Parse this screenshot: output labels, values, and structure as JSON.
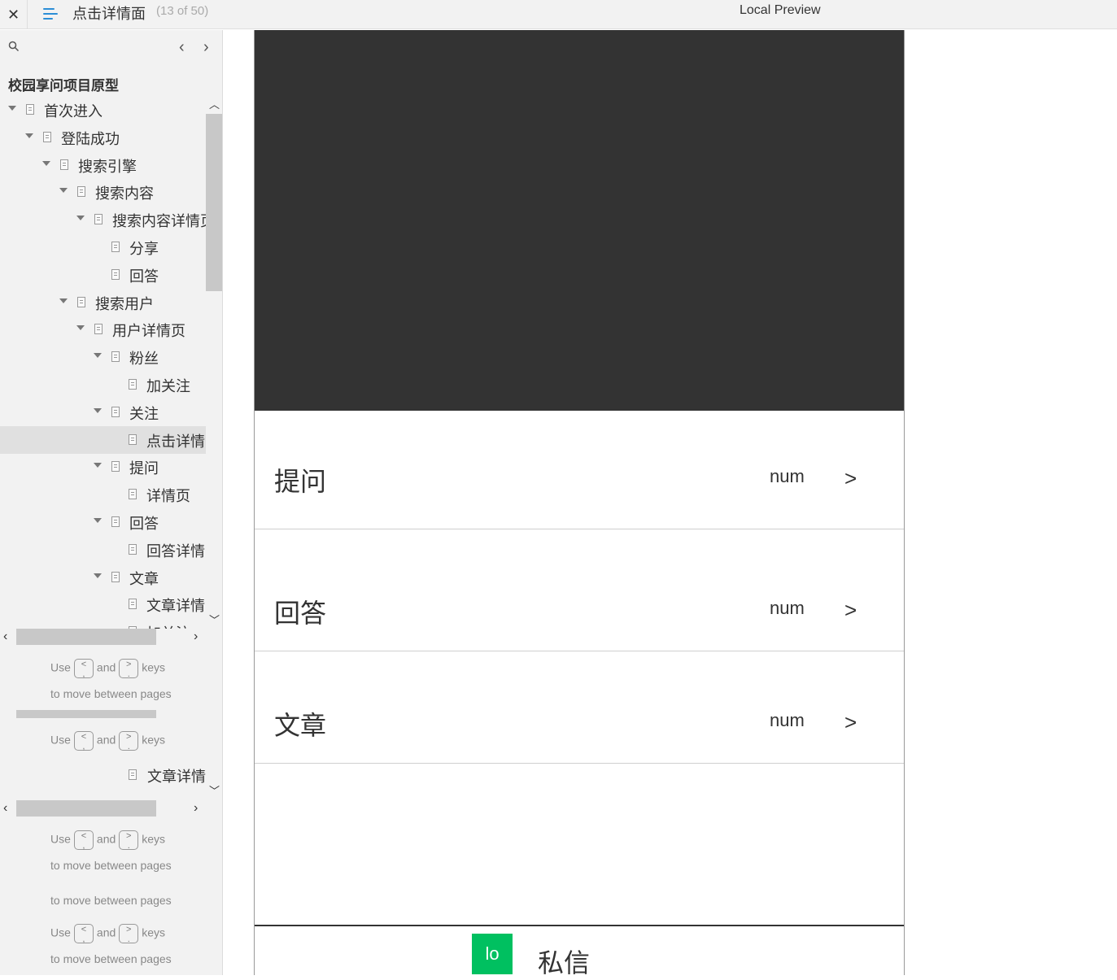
{
  "topbar": {
    "close_glyph": "✕",
    "menu_icon": "menu-icon",
    "page_title": "点击详情面",
    "page_count": "(13 of 50)",
    "preview_label": "Local Preview"
  },
  "sidebar": {
    "search_icon": "search-icon",
    "prev_glyph": "‹",
    "next_glyph": "›",
    "project_title": "校园享问项目原型",
    "tree": [
      {
        "label": "首次进入",
        "depth": 0,
        "expanded": true
      },
      {
        "label": "登陆成功",
        "depth": 1,
        "expanded": true
      },
      {
        "label": "搜索引擎",
        "depth": 2,
        "expanded": true
      },
      {
        "label": "搜索内容",
        "depth": 3,
        "expanded": true
      },
      {
        "label": "搜索内容详情页",
        "depth": 4,
        "expanded": true
      },
      {
        "label": "分享",
        "depth": 5,
        "expanded": false
      },
      {
        "label": "回答",
        "depth": 5,
        "expanded": false
      },
      {
        "label": "搜索用户",
        "depth": 3,
        "expanded": true
      },
      {
        "label": "用户详情页",
        "depth": 4,
        "expanded": true
      },
      {
        "label": "粉丝",
        "depth": 5,
        "expanded": true
      },
      {
        "label": "加关注",
        "depth": 6,
        "expanded": false
      },
      {
        "label": "关注",
        "depth": 5,
        "expanded": true
      },
      {
        "label": "点击详情",
        "depth": 6,
        "expanded": false,
        "selected": true
      },
      {
        "label": "提问",
        "depth": 5,
        "expanded": true
      },
      {
        "label": "详情页",
        "depth": 6,
        "expanded": false
      },
      {
        "label": "回答",
        "depth": 5,
        "expanded": true
      },
      {
        "label": "回答详情",
        "depth": 6,
        "expanded": false
      },
      {
        "label": "文章",
        "depth": 5,
        "expanded": true
      },
      {
        "label": "文章详情",
        "depth": 6,
        "expanded": false
      },
      {
        "label": "加关注",
        "depth": 6,
        "expanded": false
      }
    ],
    "hint": {
      "use": "Use",
      "and": "and",
      "keys": "keys",
      "prev_key": "<\n,",
      "next_key": ">\n.",
      "line2": "to move between pages"
    },
    "extra_item": "文章详情"
  },
  "preview": {
    "rows": [
      {
        "label": "提问",
        "num": "num",
        "arrow": ">"
      },
      {
        "label": "回答",
        "num": "num",
        "arrow": ">"
      },
      {
        "label": "文章",
        "num": "num",
        "arrow": ">"
      }
    ],
    "bottom": {
      "lo_label": "lo",
      "message_label": "私信"
    }
  },
  "colors": {
    "accent": "#2c8ed6",
    "banner": "#333333",
    "lo_button": "#00c060"
  }
}
